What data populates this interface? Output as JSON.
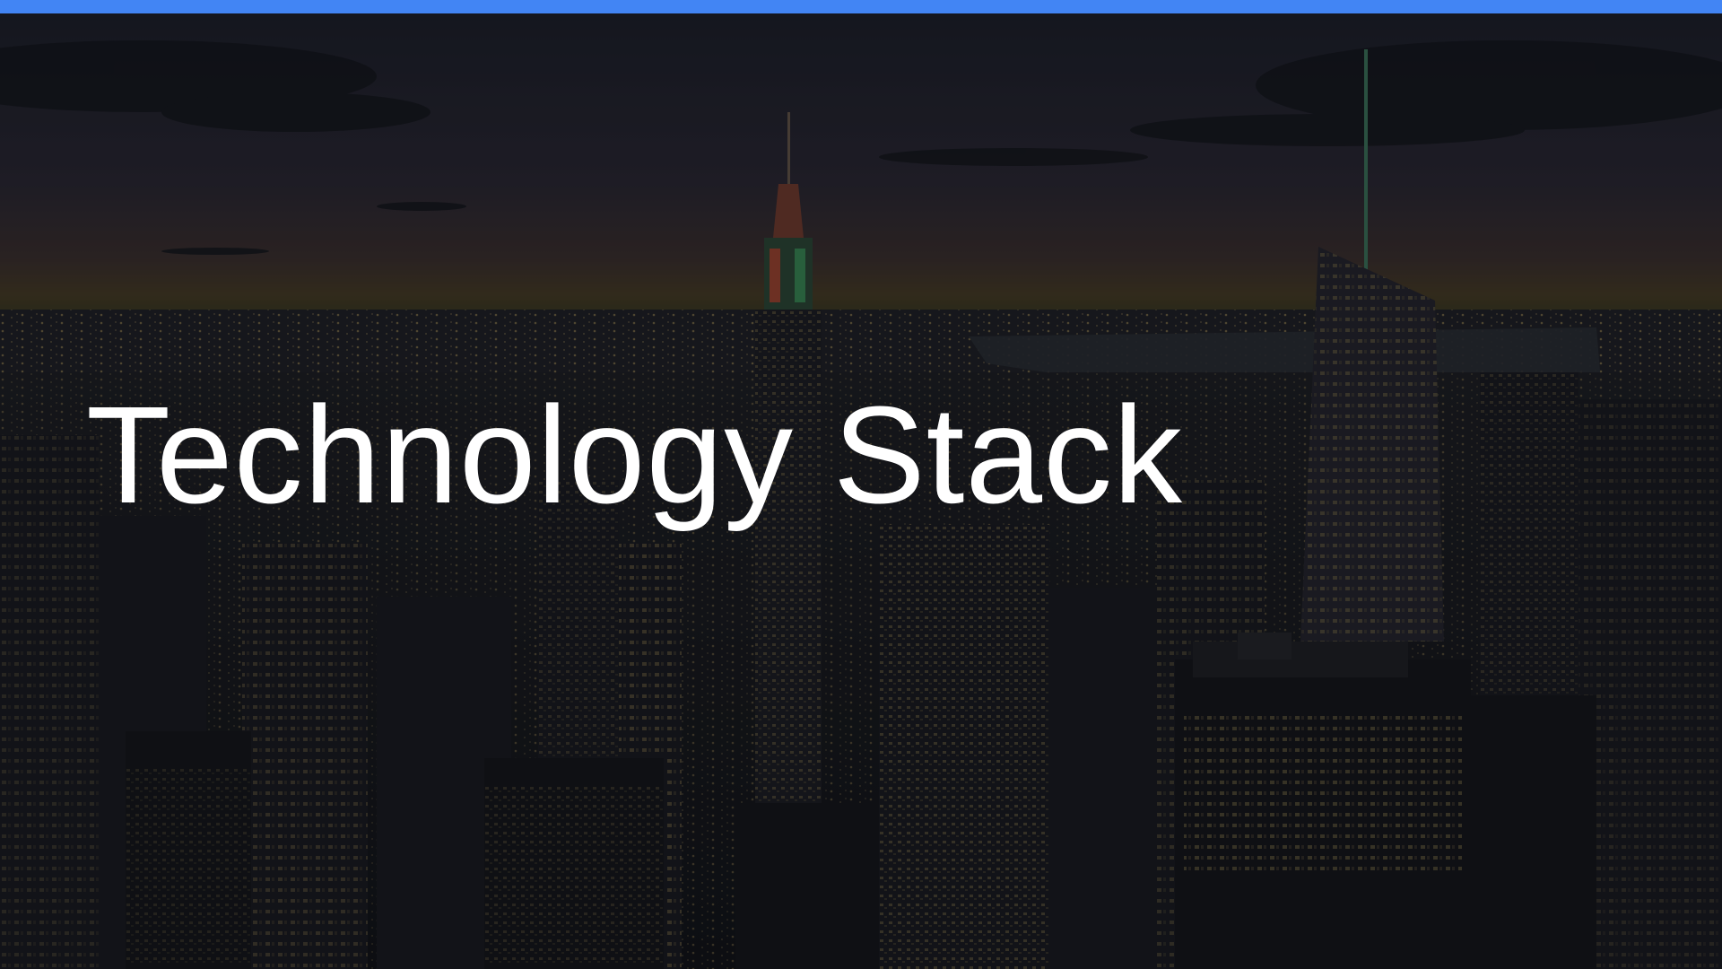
{
  "slide": {
    "title": "Technology Stack",
    "accent_color": "#4285f4",
    "title_color": "#ffffff",
    "background_image": "night-city-skyline-image"
  }
}
